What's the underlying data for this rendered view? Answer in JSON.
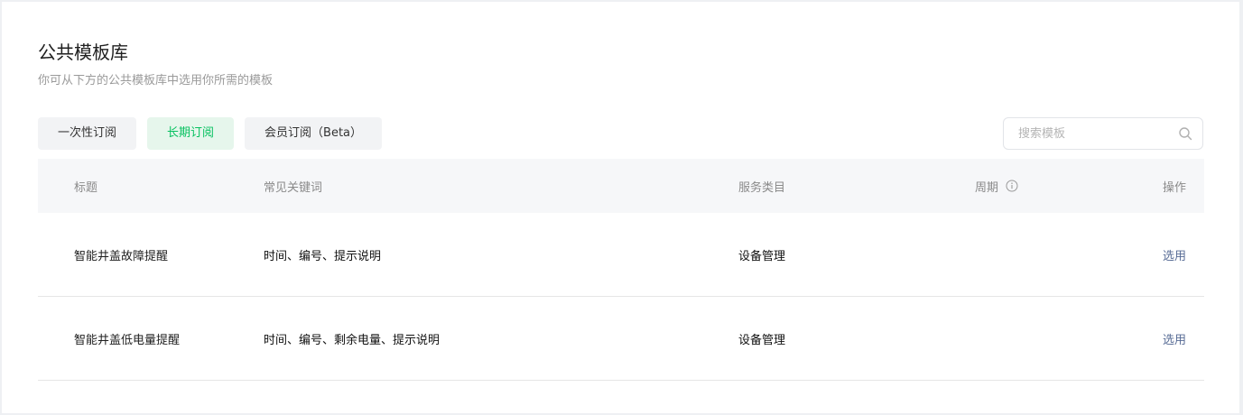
{
  "page": {
    "title": "公共模板库",
    "subtitle": "你可从下方的公共模板库中选用你所需的模板"
  },
  "tabs": [
    {
      "label": "一次性订阅",
      "active": false
    },
    {
      "label": "长期订阅",
      "active": true
    },
    {
      "label": "会员订阅（Beta）",
      "active": false
    }
  ],
  "search": {
    "placeholder": "搜索模板",
    "value": "",
    "icon": "search-icon"
  },
  "table": {
    "headers": {
      "title": "标题",
      "keywords": "常见关键词",
      "category": "服务类目",
      "period": "周期",
      "period_icon": "info-icon",
      "action": "操作"
    },
    "rows": [
      {
        "title": "智能井盖故障提醒",
        "keywords": "时间、编号、提示说明",
        "category": "设备管理",
        "period": "",
        "action": "选用"
      },
      {
        "title": "智能井盖低电量提醒",
        "keywords": "时间、编号、剩余电量、提示说明",
        "category": "设备管理",
        "period": "",
        "action": "选用"
      }
    ]
  },
  "colors": {
    "accent": "#07c160",
    "link": "#576b95",
    "header_bg": "#f6f7f9"
  }
}
